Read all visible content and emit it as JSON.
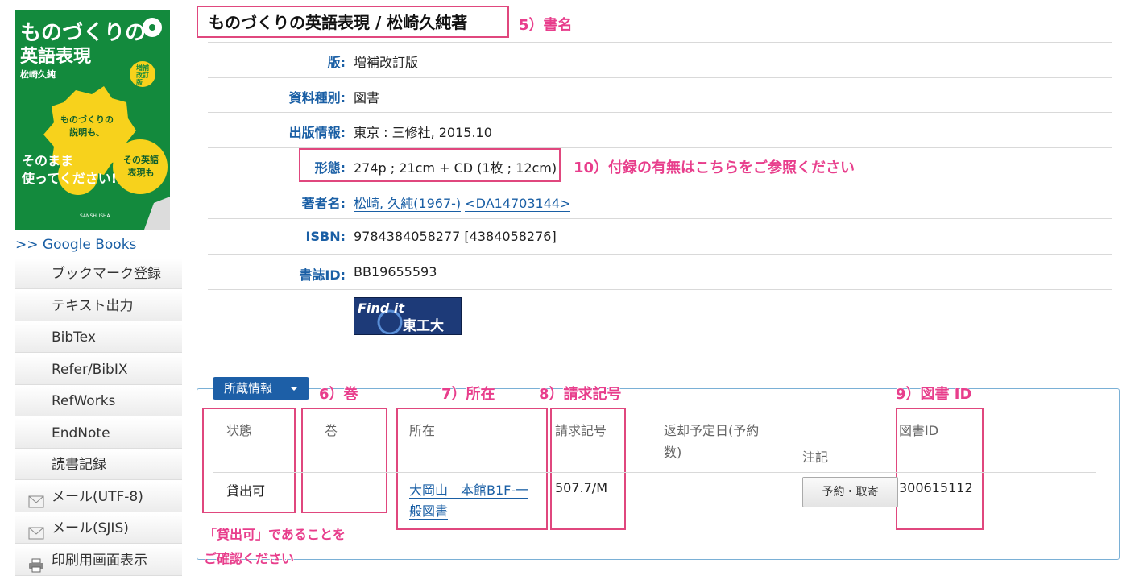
{
  "cover": {
    "title_line1": "ものづくりの",
    "title_line2": "英語表現",
    "author": "松崎久純",
    "badge": "増補改訂版",
    "gear1": "ものづくりの説明も、",
    "gear2": "その英語表現も",
    "slogan1": "そのまま",
    "slogan2": "使ってください!",
    "publisher": "SANSHUSHA"
  },
  "sidebar": {
    "google_books": ">> Google Books",
    "items": [
      {
        "label": "ブックマーク登録"
      },
      {
        "label": "テキスト出力"
      },
      {
        "label": "BibTex"
      },
      {
        "label": "Refer/BibIX"
      },
      {
        "label": "RefWorks"
      },
      {
        "label": "EndNote"
      },
      {
        "label": "読書記録"
      },
      {
        "label": "メール(UTF-8)",
        "icon": "mail-icon"
      },
      {
        "label": "メール(SJIS)",
        "icon": "mail-icon"
      },
      {
        "label": "印刷用画面表示",
        "icon": "printer-icon"
      }
    ]
  },
  "book": {
    "title": "ものづくりの英語表現 / 松崎久純著",
    "fields": [
      {
        "label": "版:",
        "value": "増補改訂版"
      },
      {
        "label": "資料種別:",
        "value": "図書"
      },
      {
        "label": "出版情報:",
        "value": "東京 : 三修社, 2015.10"
      },
      {
        "label": "形態:",
        "value": "274p ; 21cm + CD (1枚 ; 12cm)"
      },
      {
        "label": "著者名:",
        "value": "",
        "link1": "松崎, 久純(1967-)",
        "link2": "<DA14703144>"
      },
      {
        "label": "ISBN:",
        "value": "9784384058277 [4384058276]"
      },
      {
        "label": "書誌ID:",
        "value": "BB19655593"
      }
    ],
    "findit": {
      "text1": "Find it",
      "text2": "東工大"
    }
  },
  "annotations": {
    "title": "5）書名",
    "form": "10）付録の有無はこちらをご参照ください",
    "volume": "6）巻",
    "location": "7）所在",
    "callno": "8）請求記号",
    "bookid": "9）図書 ID",
    "status_note1": "「貸出可」であることを",
    "status_note2": "ご確認ください"
  },
  "holdings": {
    "button_label": "所蔵情報",
    "headers": {
      "status": "状態",
      "volume": "巻",
      "location": "所在",
      "callno": "請求記号",
      "due1": "返却予定日(予約",
      "due2": "数)",
      "note": "注記",
      "bookid": "図書ID"
    },
    "row": {
      "status": "貸出可",
      "volume": "",
      "location1": "大岡山　本館B1F-一",
      "location2": "般図書",
      "callno": "507.7/M",
      "reserve_button": "予約・取寄",
      "bookid": "300615112"
    }
  },
  "colors": {
    "accent": "#1a5fa5",
    "annotation": "#e83e8c",
    "cover_green": "#138a3d"
  }
}
